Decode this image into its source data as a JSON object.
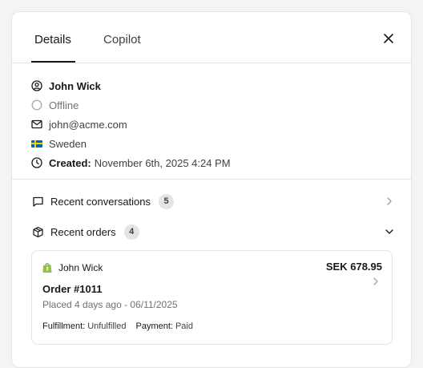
{
  "tabs": {
    "details": "Details",
    "copilot": "Copilot"
  },
  "customer": {
    "name": "John Wick",
    "status": "Offline",
    "email": "john@acme.com",
    "country": "Sweden",
    "created_label": "Created:",
    "created_value": "November 6th, 2025 4:24 PM"
  },
  "sections": {
    "conversations": {
      "label": "Recent conversations",
      "count": "5"
    },
    "orders": {
      "label": "Recent orders",
      "count": "4"
    }
  },
  "order": {
    "store_customer": "John Wick",
    "total": "SEK 678.95",
    "title": "Order #1011",
    "placed": "Placed 4 days ago - 06/11/2025",
    "fulfillment_label": "Fulfillment:",
    "fulfillment_value": "Unfulfilled",
    "payment_label": "Payment:",
    "payment_value": "Paid"
  },
  "colors": {
    "shopify_green": "#5e8e3e",
    "sweden_blue": "#006aa7",
    "sweden_yellow": "#fecc00"
  },
  "icons": {
    "close": "close-icon",
    "user": "user-circle-icon",
    "status": "status-circle-icon",
    "email": "mail-icon",
    "country": "sweden-flag-icon",
    "created": "clock-icon",
    "conversations": "message-square-icon",
    "orders": "package-icon",
    "store": "shopify-bag-icon"
  }
}
